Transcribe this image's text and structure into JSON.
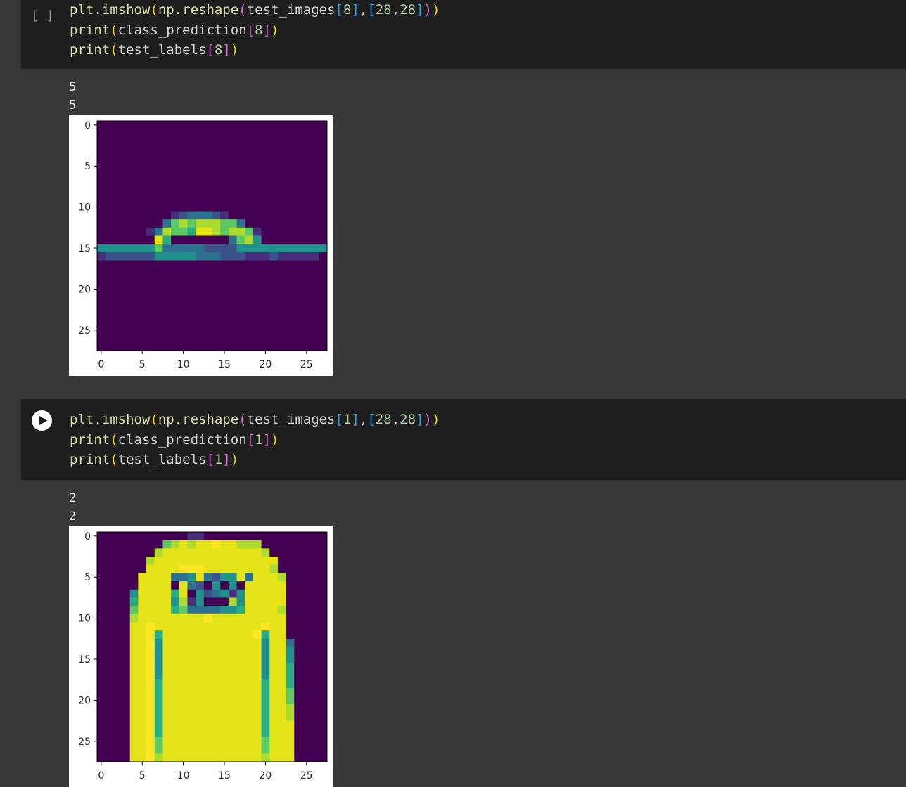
{
  "cells": [
    {
      "exec_indicator": "[ ]",
      "code_lines": [
        [
          [
            "plt.imshow",
            "fn"
          ],
          [
            "(",
            "b1"
          ],
          [
            "np.reshape",
            "fn"
          ],
          [
            "(",
            "b2"
          ],
          [
            "test_images",
            "var"
          ],
          [
            "[",
            "b3"
          ],
          [
            "8",
            "num"
          ],
          [
            "]",
            "b3"
          ],
          [
            ",",
            "var"
          ],
          [
            "[",
            "b3"
          ],
          [
            "28",
            "num"
          ],
          [
            ",",
            "var"
          ],
          [
            "28",
            "num"
          ],
          [
            "]",
            "b3"
          ],
          [
            ")",
            "b2"
          ],
          [
            ")",
            "b1"
          ]
        ],
        [
          [
            "print",
            "fn"
          ],
          [
            "(",
            "b1"
          ],
          [
            "class_prediction",
            "var"
          ],
          [
            "[",
            "b2"
          ],
          [
            "8",
            "num"
          ],
          [
            "]",
            "b2"
          ],
          [
            ")",
            "b1"
          ]
        ],
        [
          [
            "print",
            "fn"
          ],
          [
            "(",
            "b1"
          ],
          [
            "test_labels",
            "var"
          ],
          [
            "[",
            "b2"
          ],
          [
            "8",
            "num"
          ],
          [
            "]",
            "b2"
          ],
          [
            ")",
            "b1"
          ]
        ]
      ],
      "output_lines": [
        "5",
        "5"
      ],
      "image": {
        "x_ticks": [
          "0",
          "5",
          "10",
          "15",
          "20",
          "25"
        ],
        "y_ticks": [
          "0",
          "5",
          "10",
          "15",
          "20",
          "25"
        ],
        "pixels": [
          "0000000000000000000000000000",
          "0000000000000000000000000000",
          "0000000000000000000000000000",
          "0000000000000000000000000000",
          "0000000000000000000000000000",
          "0000000000000000000000000000",
          "0000000000000000000000000000",
          "0000000000000000000000000000",
          "0000000000000000000000000000",
          "0000000000000000000000000000",
          "0000000000000000000000000000",
          "0000000001233321000000000000",
          "0000000036767776630000000000",
          "0000001376658876776100000000",
          "0000000850000000367400000000",
          "4444444633333222244444444444",
          "1222222444443332221112111110",
          "0000000000000000000000000000",
          "0000000000000000000000000000",
          "0000000000000000000000000000",
          "0000000000000000000000000000",
          "0000000000000000000000000000",
          "0000000000000000000000000000",
          "0000000000000000000000000000",
          "0000000000000000000000000000",
          "0000000000000000000000000000",
          "0000000000000000000000000000",
          "0000000000000000000000000000"
        ]
      }
    },
    {
      "exec_indicator": "",
      "code_lines": [
        [
          [
            "plt.imshow",
            "fn"
          ],
          [
            "(",
            "b1"
          ],
          [
            "np.reshape",
            "fn"
          ],
          [
            "(",
            "b2"
          ],
          [
            "test_images",
            "var"
          ],
          [
            "[",
            "b3"
          ],
          [
            "1",
            "num"
          ],
          [
            "]",
            "b3"
          ],
          [
            ",",
            "var"
          ],
          [
            "[",
            "b3"
          ],
          [
            "28",
            "num"
          ],
          [
            ",",
            "var"
          ],
          [
            "28",
            "num"
          ],
          [
            "]",
            "b3"
          ],
          [
            ")",
            "b2"
          ],
          [
            ")",
            "b1"
          ]
        ],
        [
          [
            "print",
            "fn"
          ],
          [
            "(",
            "b1"
          ],
          [
            "class_prediction",
            "var"
          ],
          [
            "[",
            "b2"
          ],
          [
            "1",
            "num"
          ],
          [
            "]",
            "b2"
          ],
          [
            ")",
            "b1"
          ]
        ],
        [
          [
            "print",
            "fn"
          ],
          [
            "(",
            "b1"
          ],
          [
            "test_labels",
            "var"
          ],
          [
            "[",
            "b2"
          ],
          [
            "1",
            "num"
          ],
          [
            "]",
            "b2"
          ],
          [
            ")",
            "b1"
          ]
        ]
      ],
      "output_lines": [
        "2",
        "2"
      ],
      "image": {
        "x_ticks": [
          "0",
          "5",
          "10",
          "15",
          "20",
          "25"
        ],
        "y_ticks": [
          "0",
          "5",
          "10",
          "15",
          "20",
          "25"
        ],
        "pixels": [
          "0000000000011000000000000000",
          "0000000067878898877700000000",
          "0000000788888888888870000000",
          "0000007888888888888888000000",
          "0000008888999888888887000000",
          "0000088883348324483888700000",
          "0000088880832040408888800000",
          "0000488885804234148888800000",
          "0000588884714000748888800000",
          "0000688885633334458888700000",
          "0000788888888988888888800000",
          "0000889888888888888898800000",
          "0000889588888888888958800000",
          "0000889488888888888848830000",
          "0000889488888888888848840000",
          "0000889488888888888848840000",
          "0000889488888888888848850000",
          "0000889488888888888848850000",
          "0000889588888888888858850000",
          "0000889588888888888858860000",
          "0000889588888888888858860000",
          "0000889588888888888858870000",
          "0000889588888888888858870000",
          "0000889588888888888858880000",
          "0000889588888888888858880000",
          "0000889688888888888868880000",
          "0000889688888888888868880000",
          "0000889788888888888878880000"
        ]
      }
    }
  ],
  "colors": {
    "page_bg": "#383838",
    "code_bg": "#1e1e1e",
    "viridis": [
      "#440154",
      "#472d7b",
      "#3b528b",
      "#2c728e",
      "#21918c",
      "#28ae80",
      "#5ec962",
      "#addc30",
      "#e4e419",
      "#fde725"
    ]
  },
  "icons": {
    "run": "play-circle-icon"
  }
}
